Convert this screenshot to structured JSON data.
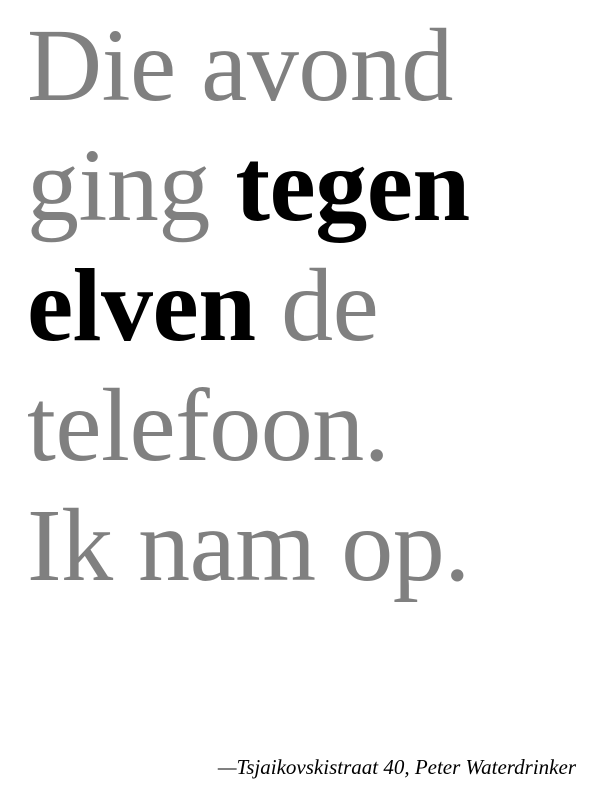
{
  "quote": {
    "line1": {
      "muted": "Die avond"
    },
    "line2": {
      "muted": "ging ",
      "strong": "tegen"
    },
    "line3": {
      "strong": "elven",
      "muted": " de"
    },
    "line4": {
      "muted": "telefoon."
    },
    "line5": {
      "muted": "Ik nam op."
    }
  },
  "attribution": "—Tsjaikovskistraat 40, Peter Waterdrinker",
  "colors": {
    "muted_text": "#808080",
    "emphasis_text": "#000000",
    "background": "#ffffff"
  }
}
